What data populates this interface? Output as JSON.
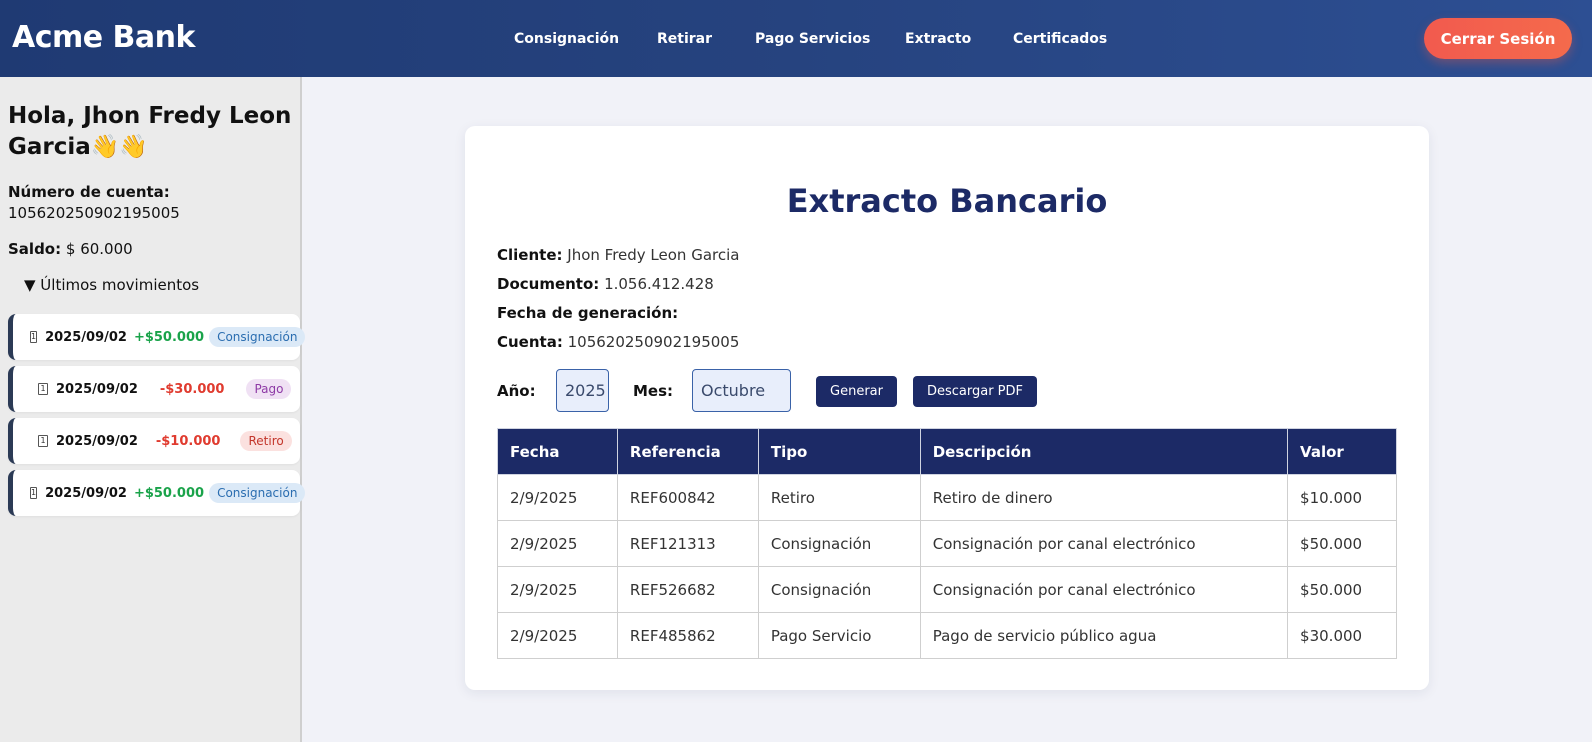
{
  "header": {
    "brand": "Acme Bank",
    "nav": [
      "Consignación",
      "Retirar",
      "Pago Servicios",
      "Extracto",
      "Certificados"
    ],
    "logout_label": "Cerrar Sesión"
  },
  "sidebar": {
    "greeting": "Hola, Jhon Fredy Leon Garcia👋👋",
    "account_label": "Número de cuenta:",
    "account_number": "105620250902195005",
    "balance_label": "Saldo:",
    "balance_value": " $ 60.000",
    "movements_toggle": "▼ Últimos movimientos",
    "movements": [
      {
        "icon": "1",
        "date": "2025/09/02",
        "amount": "+$50.000",
        "type": "Consignación"
      },
      {
        "icon": "1",
        "date": "2025/09/02",
        "amount": "-$30.000",
        "type": "Pago"
      },
      {
        "icon": "1",
        "date": "2025/09/02",
        "amount": "-$10.000",
        "type": "Retiro"
      },
      {
        "icon": "1",
        "date": "2025/09/02",
        "amount": "+$50.000",
        "type": "Consignación"
      }
    ]
  },
  "statement": {
    "title": "Extracto Bancario",
    "client_label": "Cliente:",
    "client_value": " Jhon Fredy Leon Garcia",
    "document_label": "Documento:",
    "document_value": " 1.056.412.428",
    "generated_label": "Fecha de generación:",
    "generated_value": "",
    "account_label": "Cuenta:",
    "account_value": " 105620250902195005",
    "year_label": "Año:",
    "year_value": "2025",
    "month_label": "Mes:",
    "month_value": "Octubre",
    "generate_button": "Generar",
    "download_button": "Descargar PDF",
    "columns": [
      "Fecha",
      "Referencia",
      "Tipo",
      "Descripción",
      "Valor"
    ],
    "rows": [
      [
        "2/9/2025",
        "REF600842",
        "Retiro",
        "Retiro de dinero",
        "$10.000"
      ],
      [
        "2/9/2025",
        "REF121313",
        "Consignación",
        "Consignación por canal electrónico",
        "$50.000"
      ],
      [
        "2/9/2025",
        "REF526682",
        "Consignación",
        "Consignación por canal electrónico",
        "$50.000"
      ],
      [
        "2/9/2025",
        "REF485862",
        "Pago Servicio",
        "Pago de servicio público agua",
        "$30.000"
      ]
    ]
  },
  "colors": {
    "header": "#26437f",
    "primary": "#1c2a66",
    "logout": "#f25a4e",
    "positive": "#1aa34a",
    "negative": "#e03b2f"
  }
}
